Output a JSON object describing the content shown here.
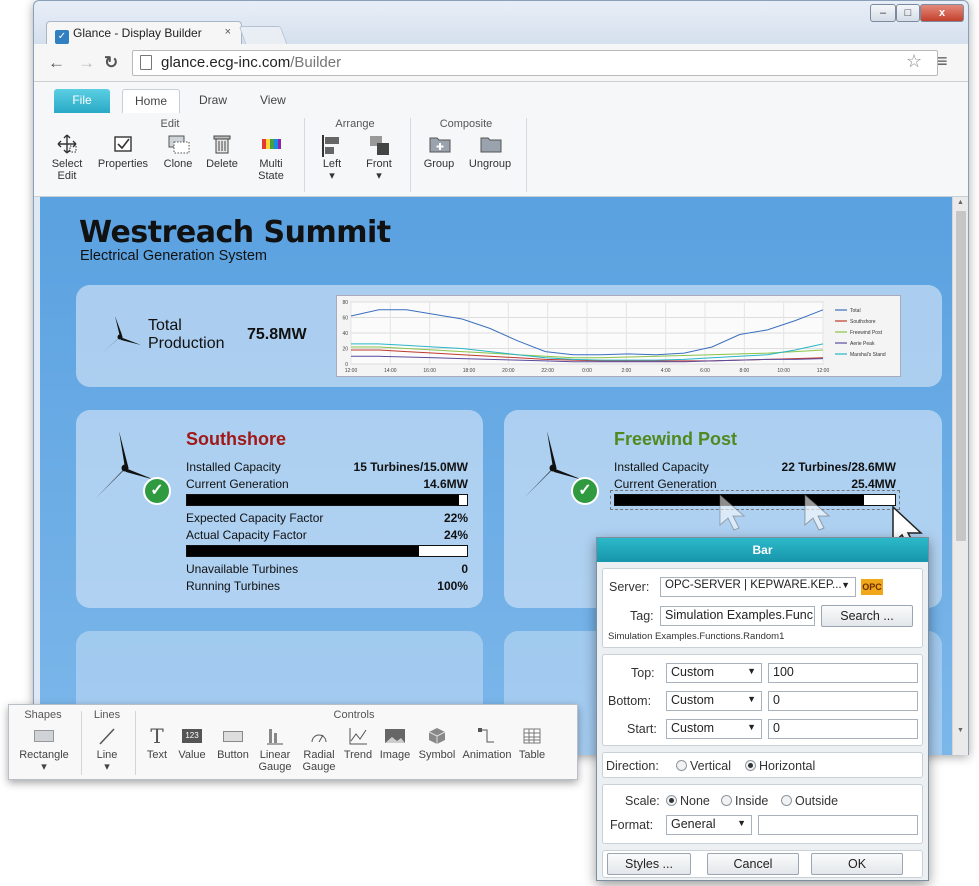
{
  "browser": {
    "tab_title": "Glance - Display Builder",
    "tab_close": "×",
    "url_host": "glance.ecg-inc.com",
    "url_path": "/Builder",
    "window_min": "–",
    "window_max": "□",
    "window_close": "x"
  },
  "ribbon": {
    "tabs": [
      "File",
      "Home",
      "Draw",
      "View"
    ],
    "groups": {
      "edit": "Edit",
      "arrange": "Arrange",
      "composite": "Composite"
    },
    "buttons": {
      "select_edit": [
        "Select",
        "Edit"
      ],
      "properties": "Properties",
      "clone": "Clone",
      "delete": "Delete",
      "multi_state": [
        "Multi",
        "State"
      ],
      "left": "Left",
      "front": "Front",
      "group": "Group",
      "ungroup": "Ungroup"
    }
  },
  "display": {
    "title": "Westreach Summit",
    "subtitle": "Electrical Generation System",
    "total": {
      "label_line1": "Total",
      "label_line2": "Production",
      "value": "75.8MW"
    },
    "trend": {
      "y_ticks": [
        "80",
        "60",
        "40",
        "20",
        "0"
      ],
      "x_ticks": [
        "12:00",
        "14:00",
        "16:00",
        "18:00",
        "20:00",
        "22:00",
        "0:00",
        "2:00",
        "4:00",
        "6:00",
        "8:00",
        "10:00",
        "12:00"
      ],
      "legend": [
        "Total",
        "Southshore",
        "Freewind Post",
        "Aerie Peak",
        "Marshal's Stand"
      ],
      "colors": [
        "#3b6fbf",
        "#c0392b",
        "#8bc34a",
        "#5b4a9e",
        "#29b6c8"
      ]
    },
    "southshore": {
      "name": "Southshore",
      "name_color": "#a01818",
      "installed_label": "Installed Capacity",
      "installed_value": "15 Turbines/15.0MW",
      "current_label": "Current Generation",
      "current_value": "14.6MW",
      "current_fraction": 0.973,
      "expected_label": "Expected Capacity Factor",
      "expected_value": "22%",
      "actual_label": "Actual Capacity Factor",
      "actual_value": "24%",
      "actual_fraction": 0.83,
      "unavailable_label": "Unavailable Turbines",
      "unavailable_value": "0",
      "running_label": "Running Turbines",
      "running_value": "100%"
    },
    "freewind": {
      "name": "Freewind Post",
      "name_color": "#4f8a21",
      "installed_label": "Installed Capacity",
      "installed_value": "22 Turbines/28.6MW",
      "current_label": "Current Generation",
      "current_value": "25.4MW",
      "current_fraction": 0.89
    }
  },
  "toolbox": {
    "groups": {
      "shapes": "Shapes",
      "lines": "Lines",
      "controls": "Controls"
    },
    "rectangle": "Rectangle",
    "line": "Line",
    "controls": [
      {
        "label1": "Text",
        "label2": ""
      },
      {
        "label1": "Value",
        "label2": ""
      },
      {
        "label1": "Button",
        "label2": ""
      },
      {
        "label1": "Linear",
        "label2": "Gauge"
      },
      {
        "label1": "Radial",
        "label2": "Gauge"
      },
      {
        "label1": "Trend",
        "label2": ""
      },
      {
        "label1": "Image",
        "label2": ""
      },
      {
        "label1": "Symbol",
        "label2": ""
      },
      {
        "label1": "Animation",
        "label2": ""
      },
      {
        "label1": "Table",
        "label2": ""
      }
    ],
    "value_icon_text": "123"
  },
  "dialog": {
    "title": "Bar",
    "server_label": "Server:",
    "server_value": "OPC-SERVER | KEPWARE.KEP...",
    "opc_badge": "OPC",
    "tag_label": "Tag:",
    "tag_value": "Simulation Examples.Func",
    "search_label": "Search ...",
    "tag_path": "Simulation Examples.Functions.Random1",
    "top_label": "Top:",
    "top_mode": "Custom",
    "top_value": "100",
    "bottom_label": "Bottom:",
    "bottom_mode": "Custom",
    "bottom_value": "0",
    "start_label": "Start:",
    "start_mode": "Custom",
    "start_value": "0",
    "direction_label": "Direction:",
    "direction_options": [
      "Vertical",
      "Horizontal"
    ],
    "direction_selected": "Horizontal",
    "scale_label": "Scale:",
    "scale_options": [
      "None",
      "Inside",
      "Outside"
    ],
    "scale_selected": "None",
    "format_label": "Format:",
    "format_value": "General",
    "format_extra": "",
    "styles_label": "Styles ...",
    "cancel_label": "Cancel",
    "ok_label": "OK"
  }
}
